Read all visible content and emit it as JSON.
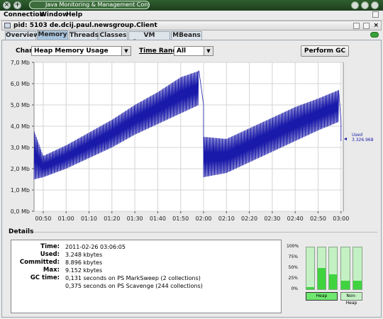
{
  "window": {
    "title": "Java Monitoring & Management Console",
    "colors": {
      "titlebar": "#264d26",
      "accent": "#a9c4dd"
    }
  },
  "menubar": {
    "items": [
      "Connection",
      "Window",
      "Help"
    ]
  },
  "connection": {
    "title": "pid: 5103 de.dcij.paul.newsgroup.Client"
  },
  "tabs": [
    {
      "label": "Overview",
      "selected": false
    },
    {
      "label": "Memory",
      "selected": true
    },
    {
      "label": "Threads",
      "selected": false
    },
    {
      "label": "Classes",
      "selected": false
    },
    {
      "label": "VM Summary",
      "selected": false
    },
    {
      "label": "MBeans",
      "selected": false
    }
  ],
  "controls": {
    "chart_label": "Chart:",
    "chart_value": "Heap Memory Usage",
    "time_range_label": "Time Range:",
    "time_range_value": "All",
    "perform_gc": "Perform GC"
  },
  "chart_data": {
    "type": "line",
    "title": "",
    "xlabel": "",
    "ylabel": "",
    "x_ticks": [
      "00:50",
      "01:00",
      "01:10",
      "01:20",
      "01:30",
      "01:40",
      "01:50",
      "02:00",
      "02:10",
      "02:20",
      "02:30",
      "02:40",
      "02:50",
      "03:00"
    ],
    "y_ticks": [
      "0,0 Mb",
      "1,0 Mb",
      "2,0 Mb",
      "3,0 Mb",
      "4,0 Mb",
      "5,0 Mb",
      "6,0 Mb",
      "7,0 Mb"
    ],
    "ylim": [
      0,
      7.0
    ],
    "unit": "Mb",
    "series": [
      {
        "color": "#1a1aaa",
        "points": [
          {
            "t": "00:46",
            "low": 1.5,
            "high": 3.8
          },
          {
            "t": "00:50",
            "low": 1.6,
            "high": 2.6
          },
          {
            "t": "01:00",
            "low": 2.0,
            "high": 3.1
          },
          {
            "t": "01:10",
            "low": 2.5,
            "high": 3.7
          },
          {
            "t": "01:20",
            "low": 3.0,
            "high": 4.3
          },
          {
            "t": "01:30",
            "low": 3.6,
            "high": 5.0
          },
          {
            "t": "01:40",
            "low": 4.1,
            "high": 5.6
          },
          {
            "t": "01:50",
            "low": 4.6,
            "high": 6.3
          },
          {
            "t": "01:58",
            "low": 5.0,
            "high": 6.6
          },
          {
            "t": "02:00",
            "low": 1.6,
            "high": 3.5
          },
          {
            "t": "02:10",
            "low": 1.8,
            "high": 3.4
          },
          {
            "t": "02:20",
            "low": 2.3,
            "high": 3.9
          },
          {
            "t": "02:30",
            "low": 2.8,
            "high": 4.4
          },
          {
            "t": "02:40",
            "low": 3.3,
            "high": 4.9
          },
          {
            "t": "02:50",
            "low": 3.8,
            "high": 5.3
          },
          {
            "t": "02:59",
            "low": 4.2,
            "high": 5.7
          },
          {
            "t": "03:00",
            "low": 1.6,
            "high": 3.3
          }
        ]
      }
    ],
    "legend": {
      "name": "Used",
      "value": "3.326.968",
      "color": "#1a1aaa"
    },
    "grid": true
  },
  "details": {
    "heading": "Details",
    "rows": [
      {
        "key": "Time:",
        "value": "2011-02-26 03:06:05"
      },
      {
        "key": "Used:",
        "value": "3.248 kbytes"
      },
      {
        "key": "Committed:",
        "value": "8.896 kbytes"
      },
      {
        "key": "Max:",
        "value": "9.152 kbytes"
      },
      {
        "key": "GC time:",
        "value": "0,131 seconds on PS MarkSweep (2 collections)"
      },
      {
        "key": "",
        "value": "0,375 seconds on PS Scavenge (244 collections)"
      }
    ]
  },
  "gauges": {
    "pct_labels": [
      "100%",
      "75%",
      "50%",
      "25%",
      "0%"
    ],
    "heap": {
      "label": "Heap",
      "bars": [
        0.05,
        0.5,
        0.35
      ]
    },
    "nonheap": {
      "label": "Non-Heap",
      "bars": [
        0.2,
        0.2
      ]
    }
  }
}
